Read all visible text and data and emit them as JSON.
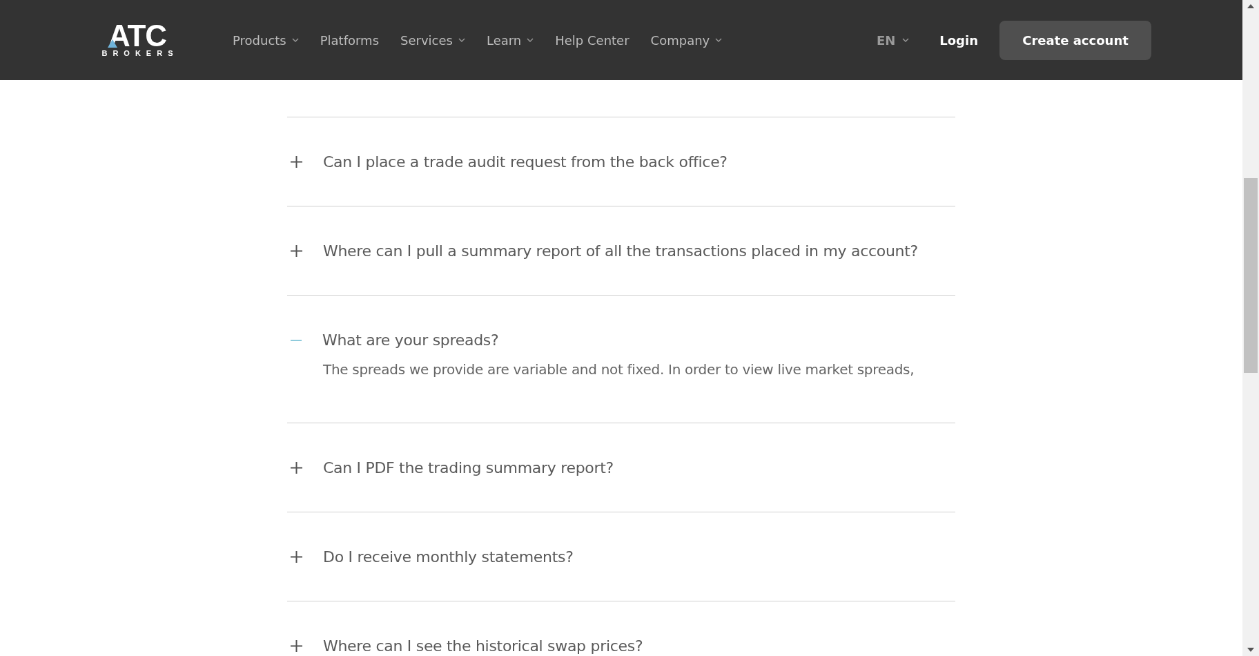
{
  "header": {
    "logo": {
      "wordmark": "ATC",
      "tagline": "BROKERS"
    },
    "nav": [
      {
        "label": "Products",
        "dropdown": true
      },
      {
        "label": "Platforms",
        "dropdown": false
      },
      {
        "label": "Services",
        "dropdown": true
      },
      {
        "label": "Learn",
        "dropdown": true
      },
      {
        "label": "Help Center",
        "dropdown": false
      },
      {
        "label": "Company",
        "dropdown": true
      }
    ],
    "language": "EN",
    "login": "Login",
    "cta": "Create account"
  },
  "faq": [
    {
      "question": "Can I place a trade audit request from the back office?",
      "expanded": false
    },
    {
      "question": "Where can I pull a summary report of all the transactions placed in my account?",
      "expanded": false
    },
    {
      "question": "What are your spreads?",
      "expanded": true,
      "answer": "The spreads we provide are variable and not fixed. In order to view live market spreads,"
    },
    {
      "question": "Can I PDF the trading summary report?",
      "expanded": false
    },
    {
      "question": "Do I receive monthly statements?",
      "expanded": false
    },
    {
      "question": "Where can I see the historical swap prices?",
      "expanded": false
    }
  ]
}
